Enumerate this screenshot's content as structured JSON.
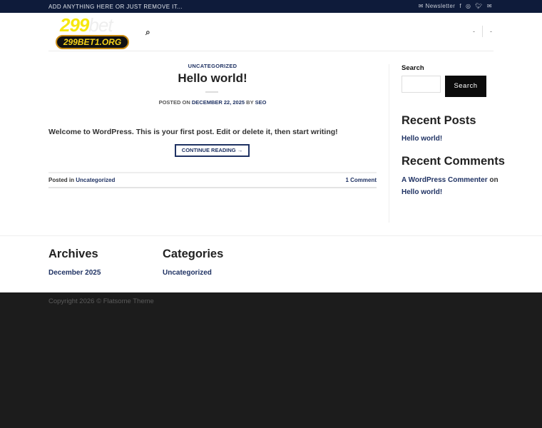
{
  "topbar": {
    "text": "ADD ANYTHING HERE OR JUST REMOVE IT...",
    "newsletter": "Newsletter"
  },
  "header": {
    "logo_text": "299bet",
    "logo_badge": "299BET1.ORG",
    "nav": [
      "-",
      "-"
    ]
  },
  "post": {
    "category": "UNCATEGORIZED",
    "title": "Hello world!",
    "posted_on": "POSTED ON",
    "date": "DECEMBER 22, 2025",
    "by": "BY",
    "author": "SEO",
    "excerpt": "Welcome to WordPress. This is your first post. Edit or delete it, then start writing!",
    "continue": "CONTINUE READING →",
    "posted_in": "Posted in",
    "posted_in_cat": "Uncategorized",
    "comments": "1 Comment"
  },
  "sidebar": {
    "search_label": "Search",
    "search_button": "Search",
    "recent_posts_title": "Recent Posts",
    "recent_post": "Hello world!",
    "recent_comments_title": "Recent Comments",
    "commenter": "A WordPress Commenter",
    "on": "on",
    "comment_post": "Hello world!"
  },
  "footer": {
    "archives_title": "Archives",
    "archive": "December 2025",
    "categories_title": "Categories",
    "category": "Uncategorized",
    "copyright": "Copyright 2026 © Flatsome Theme"
  }
}
